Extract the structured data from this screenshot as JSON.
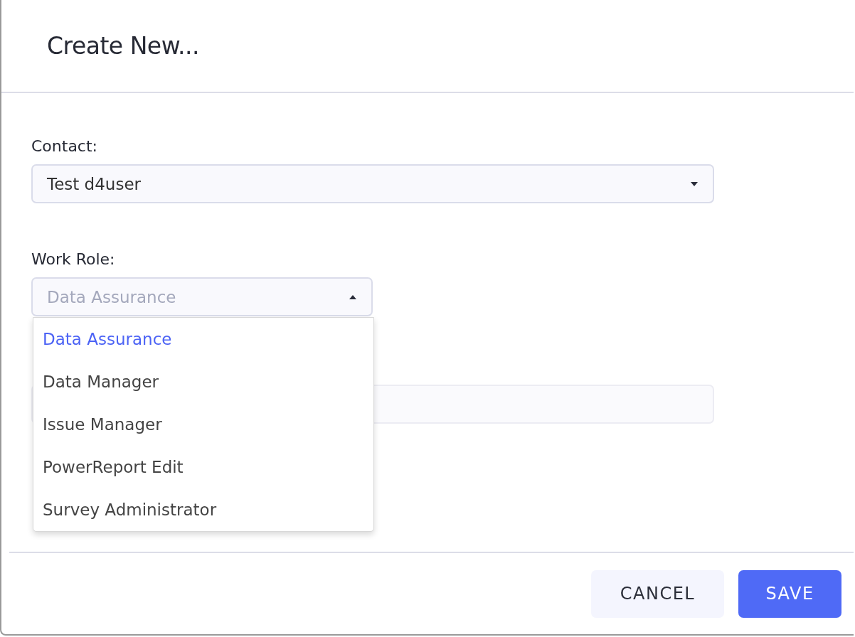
{
  "dialog": {
    "title": "Create New..."
  },
  "contact": {
    "label": "Contact:",
    "value": "Test d4user"
  },
  "work_role": {
    "label": "Work Role:",
    "value": "Data Assurance",
    "expanded": true,
    "options": [
      {
        "label": "Data Assurance",
        "selected": true
      },
      {
        "label": "Data Manager",
        "selected": false
      },
      {
        "label": "Issue Manager",
        "selected": false
      },
      {
        "label": "PowerReport Edit",
        "selected": false
      },
      {
        "label": "Survey Administrator",
        "selected": false
      }
    ]
  },
  "buttons": [
    {
      "label": "CANCEL",
      "kind": "secondary"
    },
    {
      "label": "SAVE",
      "kind": "primary"
    }
  ]
}
